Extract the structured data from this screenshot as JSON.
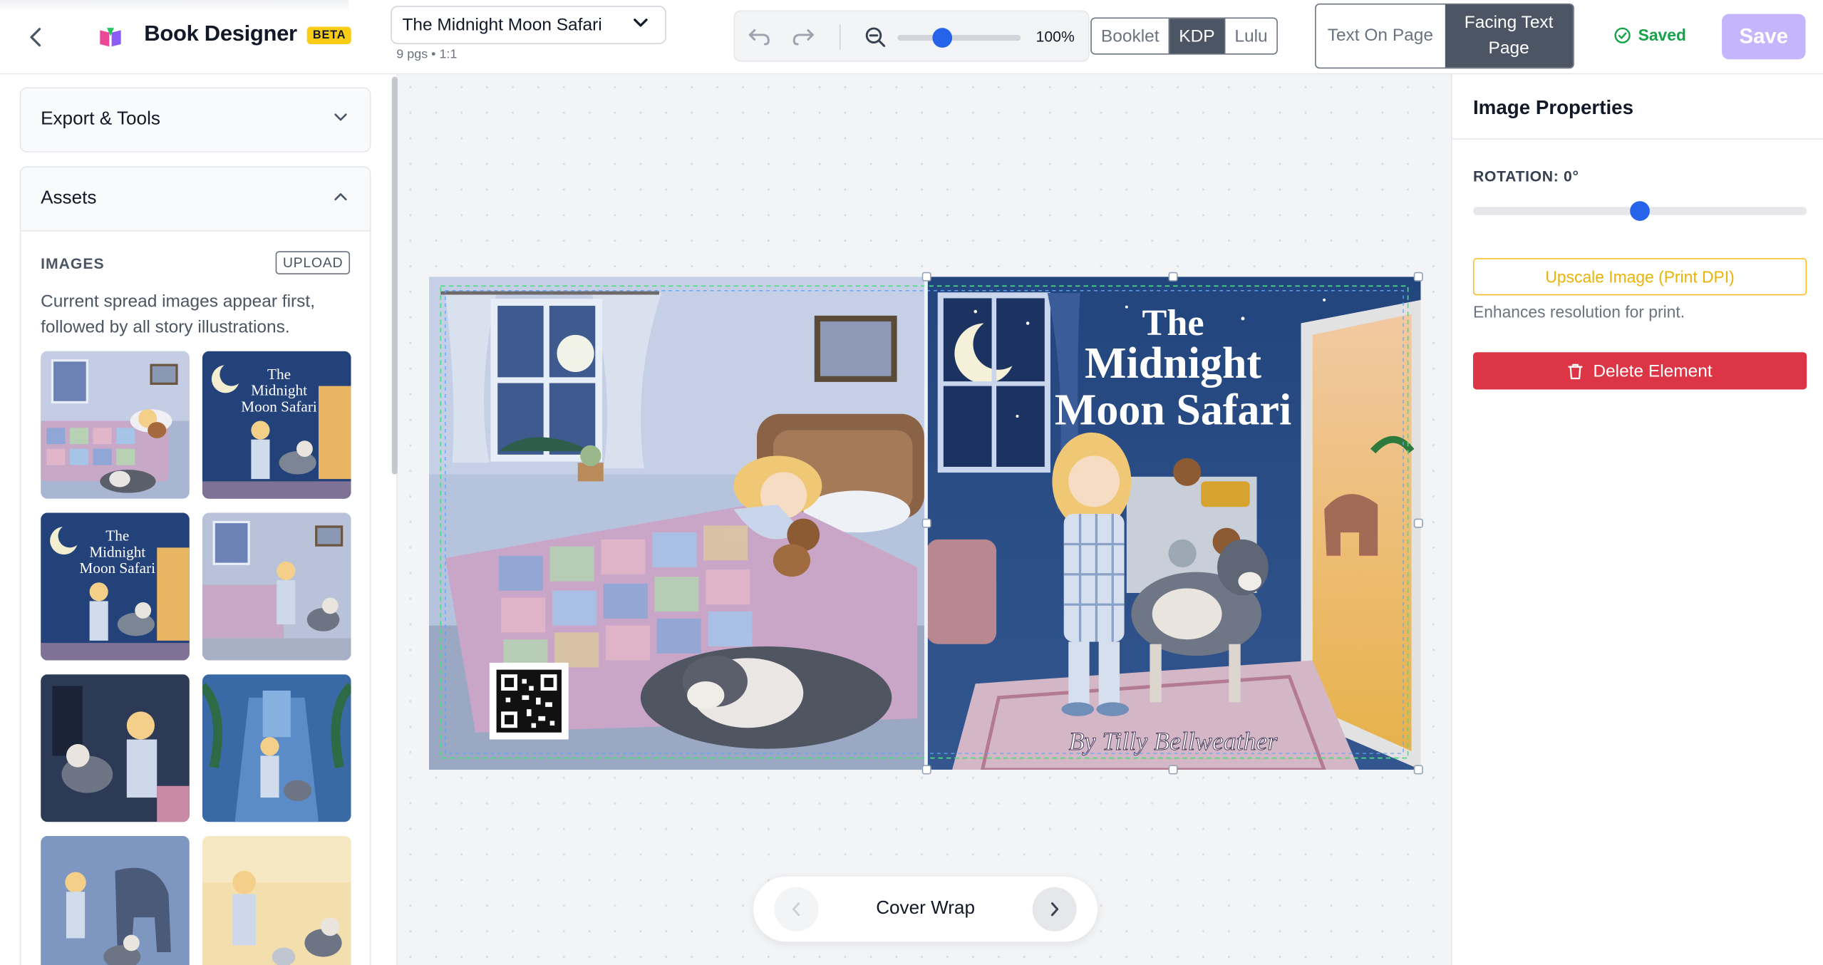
{
  "header": {
    "brand_name": "Book Designer",
    "beta_label": "BETA",
    "book_title": "The Midnight Moon Safari",
    "pages_meta": "9 pgs • 1:1",
    "zoom_label": "100%",
    "zoom_value": 0.36,
    "formats": [
      {
        "label": "Booklet",
        "active": false
      },
      {
        "label": "KDP",
        "active": true
      },
      {
        "label": "Lulu",
        "active": false
      }
    ],
    "layouts": [
      {
        "label": "Text On Page",
        "active": false
      },
      {
        "label": "Facing Text Page",
        "active": true
      }
    ],
    "saved_label": "Saved",
    "save_label": "Save"
  },
  "sidebar": {
    "export_tools_label": "Export & Tools",
    "assets_label": "Assets",
    "images_heading": "IMAGES",
    "upload_label": "UPLOAD",
    "images_description": "Current spread images appear first, followed by all story illustrations.",
    "thumbnails": [
      {
        "name": "bedroom-sleeping-girl",
        "cover_title": ""
      },
      {
        "name": "cover-front",
        "cover_title": "The Midnight Moon Safari"
      },
      {
        "name": "cover-front-copy",
        "cover_title": "The Midnight Moon Safari"
      },
      {
        "name": "girl-making-bed",
        "cover_title": ""
      },
      {
        "name": "girl-with-dog-dark-room",
        "cover_title": ""
      },
      {
        "name": "girl-in-blue-hallway",
        "cover_title": ""
      },
      {
        "name": "elephant-shadow",
        "cover_title": ""
      },
      {
        "name": "girl-vacuuming-with-dog",
        "cover_title": ""
      }
    ]
  },
  "canvas": {
    "cover_title_line1": "The",
    "cover_title_line2": "Midnight",
    "cover_title_line3": "Moon Safari",
    "cover_author": "By Tilly Bellweather",
    "page_label": "Cover Wrap"
  },
  "properties": {
    "title": "Image Properties",
    "rotation_label": "ROTATION: 0°",
    "rotation_value": 0.5,
    "upscale_label": "Upscale Image (Print DPI)",
    "upscale_hint": "Enhances resolution for print.",
    "delete_label": "Delete Element"
  },
  "colors": {
    "accent": "#2563eb",
    "save_disabled": "#c4b5fd",
    "saved_green": "#16a34a",
    "delete_red": "#dc3545",
    "upscale_yellow": "#eab308",
    "active_toggle": "#4b5563"
  }
}
